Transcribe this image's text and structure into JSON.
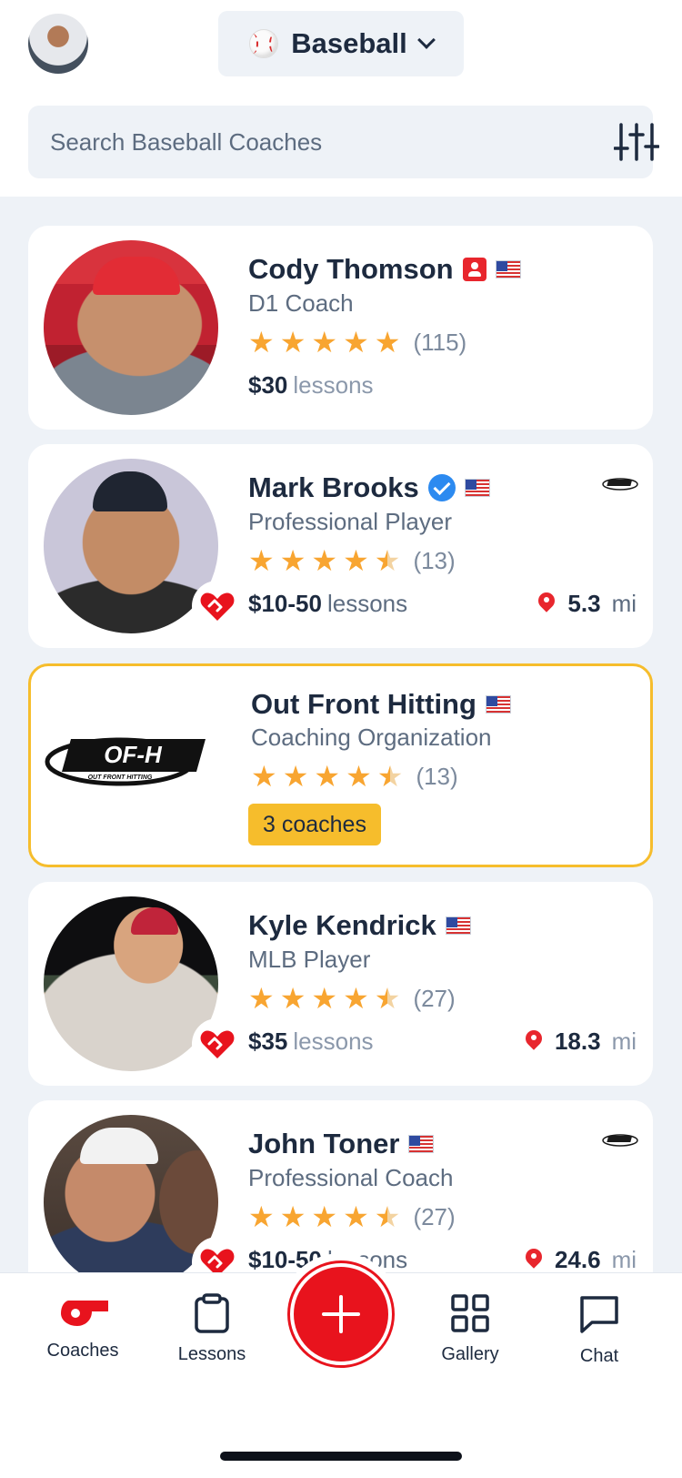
{
  "header": {
    "sport": "Baseball",
    "search_placeholder": "Search Baseball Coaches"
  },
  "cards": [
    {
      "name": "Cody Thomson",
      "role": "D1 Coach",
      "rating": 5,
      "reviews": "(115)",
      "price": "$30",
      "price_suffix": "lessons"
    },
    {
      "name": "Mark Brooks",
      "role": "Professional Player",
      "rating": 4.5,
      "reviews": "(13)",
      "price": "$10-50",
      "price_suffix": "lessons",
      "distance": "5.3",
      "distance_unit": "mi"
    },
    {
      "name": "Out Front Hitting",
      "role": "Coaching Organization",
      "rating": 4.5,
      "reviews": "(13)",
      "badge": "3 coaches",
      "logo_text": "OUT FRONT HITTING"
    },
    {
      "name": "Kyle Kendrick",
      "role": "MLB Player",
      "rating": 4.5,
      "reviews": "(27)",
      "price": "$35",
      "price_suffix": "lessons",
      "distance": "18.3",
      "distance_unit": "mi"
    },
    {
      "name": "John Toner",
      "role": "Professional Coach",
      "rating": 4.5,
      "reviews": "(27)",
      "price": "$10-50",
      "price_suffix": "lessons",
      "distance": "24.6",
      "distance_unit": "mi"
    }
  ],
  "tabs": [
    {
      "label": "Coaches",
      "icon": "whistle-icon"
    },
    {
      "label": "Lessons",
      "icon": "clipboard-icon"
    },
    {
      "label": "Gallery",
      "icon": "grid-icon"
    },
    {
      "label": "Chat",
      "icon": "chat-icon"
    }
  ],
  "colors": {
    "accent": "#e8131d",
    "star": "#f8a531",
    "org_border": "#f6bd2c",
    "text": "#1d2a3f",
    "muted": "#5d6c80"
  }
}
